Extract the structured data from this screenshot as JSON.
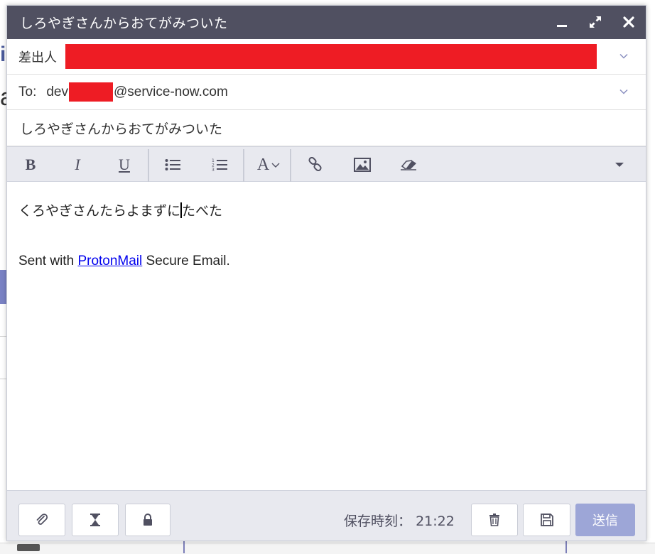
{
  "window": {
    "title": "しろやぎさんからおてがみついた",
    "controls": [
      "minimize-icon",
      "maximize-icon",
      "close-icon"
    ]
  },
  "from": {
    "label": "差出人",
    "value_redacted": true
  },
  "to": {
    "label": "To:",
    "prefix": "dev",
    "suffix": "@service-now.com"
  },
  "subject": {
    "value": "しろやぎさんからおてがみついた"
  },
  "toolbar": {
    "bold": "B",
    "italic": "I",
    "underline": "U",
    "font": "A",
    "icons": [
      "bold-icon",
      "italic-icon",
      "underline-icon",
      "bulleted-list-icon",
      "numbered-list-icon",
      "font-icon",
      "link-icon",
      "image-icon",
      "eraser-icon",
      "more-icon"
    ]
  },
  "body": {
    "line1_before_caret": "くろやぎさんたらよまずに",
    "line1_after_caret": "たべた",
    "signature_before": "Sent with ",
    "signature_link": "ProtonMail",
    "signature_after": " Secure Email."
  },
  "footer": {
    "save_label": "保存時刻：",
    "save_time": "21:22",
    "send_label": "送信",
    "send_color": "#9da6d7",
    "icons": [
      "paperclip-icon",
      "hourglass-icon",
      "lock-icon",
      "trash-icon",
      "save-icon"
    ]
  },
  "colors": {
    "titlebar": "#505061",
    "redaction": "#ee1c24",
    "toolbar_bg": "#e8e9ef"
  }
}
